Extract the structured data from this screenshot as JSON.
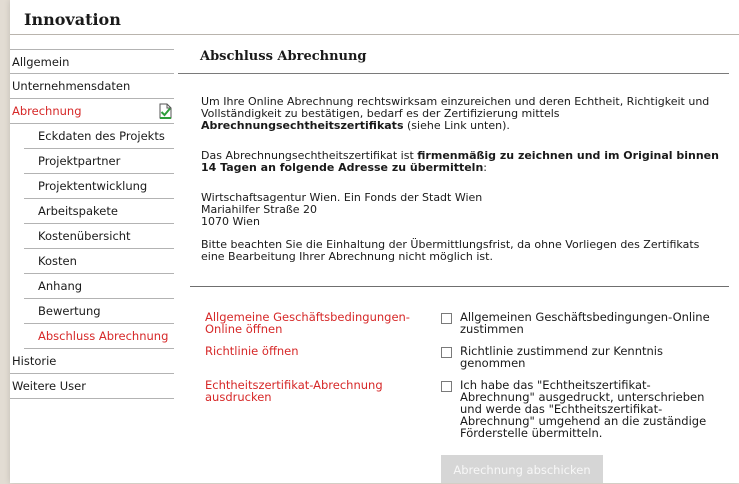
{
  "app": {
    "title": "Innovation"
  },
  "sidebar": {
    "items": [
      {
        "label": "Allgemein"
      },
      {
        "label": "Unternehmensdaten"
      },
      {
        "label": "Abrechnung"
      },
      {
        "label": "Eckdaten des Projekts"
      },
      {
        "label": "Projektpartner"
      },
      {
        "label": "Projektentwicklung"
      },
      {
        "label": "Arbeitspakete"
      },
      {
        "label": "Kostenübersicht"
      },
      {
        "label": "Kosten"
      },
      {
        "label": "Anhang"
      },
      {
        "label": "Bewertung"
      },
      {
        "label": "Abschluss Abrechnung"
      },
      {
        "label": "Historie"
      },
      {
        "label": "Weitere User"
      }
    ]
  },
  "main": {
    "title": "Abschluss Abrechnung",
    "p1_a": "Um Ihre Online Abrechnung rechtswirksam einzureichen und deren Echtheit, Richtigkeit und Vollständigkeit zu bestätigen, bedarf es der Zertifizierung mittels ",
    "p1_b": "Abrechnungsechtheitszertifikats",
    "p1_c": " (siehe Link unten).",
    "p2_a": "Das Abrechnungsechtheitszertifikat ist ",
    "p2_b": "firmenmäßig zu zeichnen und im Original binnen 14 Tagen an folgende Adresse zu übermitteln",
    "p2_c": ":",
    "address_line1": "Wirtschaftsagentur Wien. Ein Fonds der Stadt Wien",
    "address_line2": "Mariahilfer Straße 20",
    "address_line3": "1070 Wien",
    "p3": "Bitte beachten Sie die Einhaltung der Übermittlungsfrist, da ohne Vorliegen des Zertifikats eine Bearbeitung Ihrer Abrechnung nicht möglich ist."
  },
  "links": {
    "agb": "Allgemeine Geschäftsbedingungen-Online öffnen",
    "richtlinie": "Richtlinie öffnen",
    "zertifikat": "Echtheitszertifikat-Abrechnung ausdrucken"
  },
  "checks": {
    "agb": "Allgemeinen Geschäftsbedingungen-Online zustimmen",
    "richtlinie": "Richtlinie zustimmend zur Kenntnis genommen",
    "zertifikat": "Ich habe das \"Echtheitszertifikat-Abrechnung\" ausgedruckt, unterschrieben und werde das \"Echtheitszertifikat-Abrechnung\" umgehend an die zuständige Förderstelle übermitteln."
  },
  "submit_label": "Abrechnung abschicken",
  "colors": {
    "accent": "#d62828",
    "check": "#2e9e3a",
    "disabled_button": "#d6d6d6"
  }
}
